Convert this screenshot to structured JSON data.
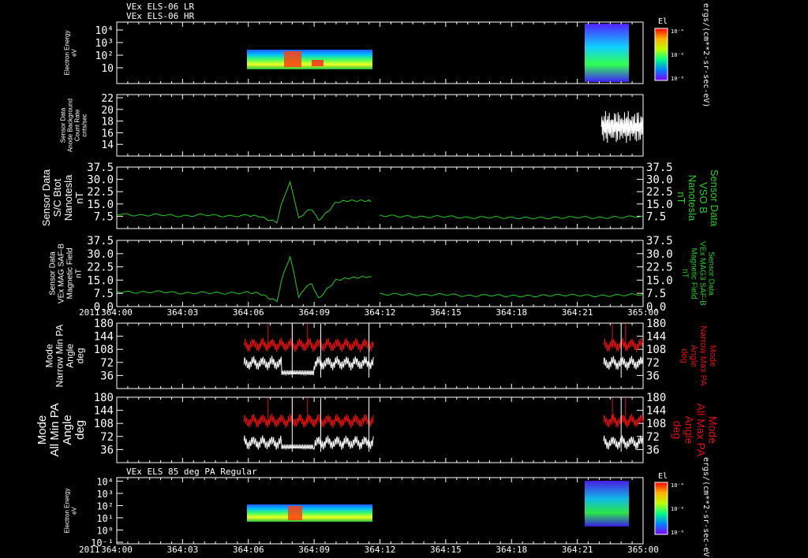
{
  "header": {
    "title_line1": "VEx ELS-06 LR",
    "title_line2": "VEx ELS-06 HR",
    "colorbar_units": "ergs/(cm**2-sr-sec-eV)"
  },
  "x_axis": {
    "year_label": "2011",
    "tick_labels": [
      "364:00",
      "364:03",
      "364:06",
      "364:09",
      "364:12",
      "364:15",
      "364:18",
      "364:21",
      "365:00"
    ]
  },
  "colors": {
    "background": "#000000",
    "axes": "#ffffff",
    "mag_trace": "#22cc22",
    "max_pa_trace": "#e01010",
    "min_pa_trace": "#ffffff",
    "right_label_green": "#22cc22",
    "right_label_red": "#e01010"
  },
  "chart_data": [
    {
      "id": "electron-energy-spectrogram",
      "type": "heatmap",
      "ylabel": [
        "Electron Energy",
        "eV"
      ],
      "yscale": "log",
      "y_tick_labels": [
        "10",
        "10²",
        "10³",
        "10⁴"
      ],
      "colorbar_title": "El",
      "colorbar_tick_labels": [
        "10⁻⁴",
        "10⁻⁶",
        "10⁻⁸"
      ],
      "data_intervals_hours": [
        [
          5.8,
          11.7
        ],
        [
          22.2,
          24.0
        ]
      ]
    },
    {
      "id": "anode-background",
      "type": "line",
      "ylabel": [
        "Sensor Data",
        "Anode Background",
        "Count Rate",
        "cnts/sec"
      ],
      "ylim": [
        12,
        22
      ],
      "y_tick_labels": [
        "14",
        "16",
        "18",
        "20",
        "22"
      ],
      "x_range_hours": [
        22.1,
        24.0
      ],
      "value_range": [
        13.0,
        21.0
      ]
    },
    {
      "id": "btot-sc",
      "type": "line",
      "ylabel": [
        "Sensor Data",
        "S/C Btot",
        "Nanotesla",
        "nT"
      ],
      "right_label": [
        "Sensor Data",
        "VSO B",
        "Nanotesla",
        "nT"
      ],
      "ylim": [
        0,
        37.5
      ],
      "y_tick_labels": [
        "7.5",
        "15.0",
        "22.5",
        "30.0",
        "37.5"
      ],
      "series": [
        {
          "x": [
            0,
            1,
            2,
            3,
            4,
            5,
            6,
            6.5,
            7,
            7.3,
            7.5,
            7.7,
            7.9,
            8.1,
            8.3,
            8.6,
            8.9,
            9.2,
            9.6,
            10,
            10.5,
            11,
            11.5,
            11.6,
            12,
            13,
            14,
            15,
            16,
            17,
            18,
            19,
            20,
            21,
            22,
            23,
            24
          ],
          "y": [
            9,
            8,
            8.5,
            7.5,
            8.5,
            7.5,
            8,
            7.5,
            5,
            4,
            14,
            22,
            28,
            18,
            6,
            10,
            12,
            5,
            10,
            16,
            17,
            17,
            17,
            17,
            8,
            7.5,
            7,
            7.5,
            6.5,
            7,
            6.5,
            6.5,
            6.5,
            7,
            6.5,
            7,
            7.5
          ]
        }
      ]
    },
    {
      "id": "mag3-saf-b",
      "type": "line",
      "ylabel": [
        "Sensor Data",
        "VEx MAG SAF-B",
        "Magnetic Field",
        "nT"
      ],
      "right_label": [
        "Sensor Data",
        "VEx MAG3 SAF-B",
        "Magnetic Field",
        "nT"
      ],
      "ylim": [
        0,
        37.5
      ],
      "y_tick_labels": [
        "0.0",
        "7.5",
        "15.0",
        "22.5",
        "30.0",
        "37.5"
      ],
      "series": [
        {
          "x": [
            0,
            1,
            2,
            3,
            4,
            5,
            6,
            6.5,
            7,
            7.3,
            7.5,
            7.7,
            7.9,
            8.1,
            8.3,
            8.6,
            8.9,
            9.2,
            9.6,
            10,
            10.5,
            11,
            11.5,
            11.6,
            12,
            13,
            14,
            15,
            16,
            17,
            18,
            19,
            20,
            21,
            22,
            23,
            24
          ],
          "y": [
            8.5,
            8,
            8.5,
            7.5,
            8,
            7.5,
            8,
            7.5,
            4.5,
            3,
            14,
            22,
            28,
            18,
            5,
            11,
            13,
            4.5,
            10,
            15,
            16,
            16.5,
            17,
            17,
            7,
            7,
            6.5,
            7,
            6,
            6.5,
            6,
            6,
            6.5,
            6.5,
            6,
            6.5,
            7
          ]
        }
      ]
    },
    {
      "id": "narrow-pitch-angle",
      "type": "line",
      "ylabel": [
        "Mode",
        "Narrow Min PA",
        "Angle",
        "deg"
      ],
      "right_label": [
        "Mode",
        "Narrow Max PA",
        "Angle",
        "deg"
      ],
      "ylim": [
        0,
        180
      ],
      "y_tick_labels": [
        "36",
        "72",
        "108",
        "144",
        "180"
      ],
      "series": [
        {
          "name": "Max PA",
          "color": "red",
          "ranges_hours": [
            [
              5.8,
              11.7
            ],
            [
              22.2,
              24.0
            ]
          ],
          "baseline": 120
        },
        {
          "name": "Min PA",
          "color": "white",
          "ranges_hours": [
            [
              5.8,
              11.7
            ],
            [
              22.2,
              24.0
            ]
          ],
          "baseline": 70
        }
      ]
    },
    {
      "id": "all-pitch-angle",
      "type": "line",
      "ylabel": [
        "Mode",
        "All Min PA",
        "Angle",
        "deg"
      ],
      "right_label": [
        "Mode",
        "All Max PA",
        "Angle",
        "deg"
      ],
      "ylim": [
        0,
        180
      ],
      "y_tick_labels": [
        "36",
        "72",
        "108",
        "144",
        "180"
      ],
      "series": [
        {
          "name": "Max PA",
          "color": "red",
          "ranges_hours": [
            [
              5.8,
              11.7
            ],
            [
              22.2,
              24.0
            ]
          ],
          "baseline": 115
        },
        {
          "name": "Min PA",
          "color": "white",
          "ranges_hours": [
            [
              5.8,
              11.7
            ],
            [
              22.2,
              24.0
            ]
          ],
          "baseline": 55
        }
      ]
    },
    {
      "id": "els-85deg-spectrogram",
      "type": "heatmap",
      "title": "VEx ELS 85 deg PA Regular",
      "ylabel": [
        "Electron Energy",
        "eV"
      ],
      "yscale": "log",
      "y_tick_labels": [
        "10⁻¹",
        "10⁰",
        "10¹",
        "10²",
        "10³",
        "10⁴"
      ],
      "colorbar_title": "El",
      "colorbar_tick_labels": [
        "10⁻⁴",
        "10⁻⁶",
        "10⁻⁸"
      ],
      "data_intervals_hours": [
        [
          5.8,
          11.7
        ],
        [
          22.2,
          24.0
        ]
      ]
    }
  ]
}
